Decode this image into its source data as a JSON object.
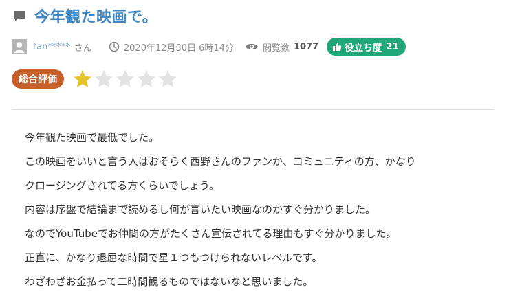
{
  "review": {
    "title": "今年観た映画で。",
    "title_icon": "comment-icon",
    "user": {
      "name": "tan*****",
      "suffix": "さん",
      "avatar_icon": "user-avatar-icon"
    },
    "date": "2020年12月30日 6時14分",
    "date_icon": "clock-icon",
    "views": {
      "label": "閲覧数",
      "count": "1077",
      "icon": "eye-icon"
    },
    "helpful": {
      "label": "役立ち度",
      "count": "21",
      "icon": "thumbs-up-icon",
      "color": "#21a67a"
    },
    "rating": {
      "label": "総合評価",
      "color": "#c65f2a",
      "value": 1,
      "max": 5,
      "star_color_filled": "#e6c42b",
      "star_color_empty": "#e3e3e3"
    },
    "body_lines": [
      "今年観た映画で最低でした。",
      "この映画をいいと言う人はおそらく西野さんのファンか、コミュニティの方、かなり",
      "クロージングされてる方くらいでしょう。",
      "内容は序盤で結論まで読めるし何が言いたい映画なのかすぐ分かりました。",
      "なのでYouTubeでお仲間の方がたくさん宣伝されてる理由もすぐ分かりました。",
      "正直に、かなり退屈な時間で星１つもつけられないレベルです。",
      "わざわざお金払って二時間観るものではないなと思いました。"
    ]
  }
}
